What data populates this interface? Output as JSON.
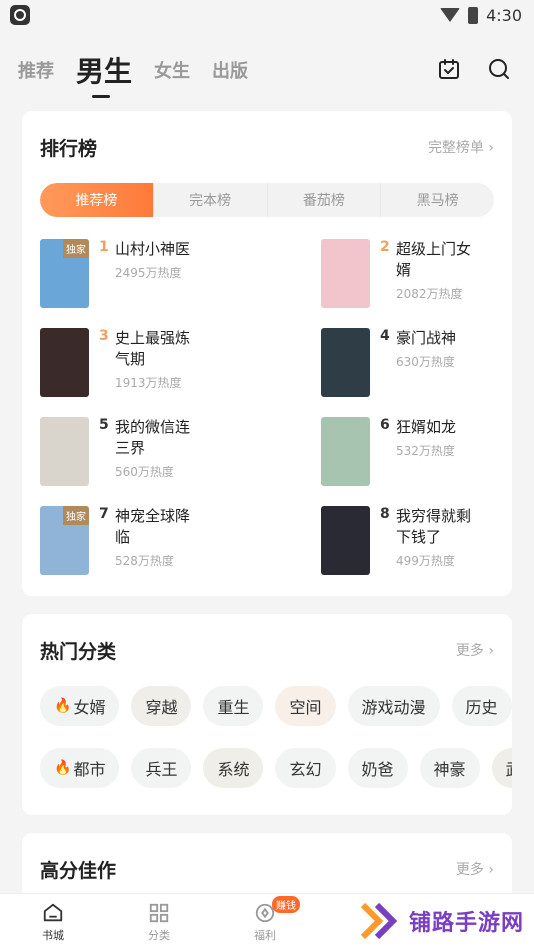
{
  "status": {
    "time": "4:30"
  },
  "topnav": {
    "tabs": [
      {
        "label": "推荐"
      },
      {
        "label": "男生"
      },
      {
        "label": "女生"
      },
      {
        "label": "出版"
      }
    ]
  },
  "ranking": {
    "title": "排行榜",
    "more": "完整榜单",
    "tabs": [
      "推荐榜",
      "完本榜",
      "番茄榜",
      "黑马榜"
    ],
    "books": [
      {
        "rank": "1",
        "title": "山村小神医",
        "heat": "2495万热度",
        "badge": "独家",
        "cover_color": "#6aa6d8"
      },
      {
        "rank": "2",
        "title": "超级上门女婿",
        "heat": "2082万热度",
        "badge": "",
        "cover_color": "#f2c4cc"
      },
      {
        "rank": "3",
        "title": "史上最强炼气期",
        "heat": "1913万热度",
        "badge": "",
        "cover_color": "#3a2a2a"
      },
      {
        "rank": "4",
        "title": "豪门战神",
        "heat": "630万热度",
        "badge": "",
        "cover_color": "#2f3e46"
      },
      {
        "rank": "5",
        "title": "我的微信连三界",
        "heat": "560万热度",
        "badge": "",
        "cover_color": "#d9d4cc"
      },
      {
        "rank": "6",
        "title": "狂婿如龙",
        "heat": "532万热度",
        "badge": "",
        "cover_color": "#a7c4b0"
      },
      {
        "rank": "7",
        "title": "神宠全球降临",
        "heat": "528万热度",
        "badge": "独家",
        "cover_color": "#8fb4d8"
      },
      {
        "rank": "8",
        "title": "我穷得就剩下钱了",
        "heat": "499万热度",
        "badge": "",
        "cover_color": "#2a2a34"
      }
    ]
  },
  "categories": {
    "title": "热门分类",
    "more": "更多",
    "row1": [
      "女婿",
      "穿越",
      "重生",
      "空间",
      "游戏动漫",
      "历史"
    ],
    "row2": [
      "都市",
      "兵王",
      "系统",
      "玄幻",
      "奶爸",
      "神豪",
      "武侠"
    ]
  },
  "high": {
    "title": "高分佳作",
    "more": "更多"
  },
  "bottom": {
    "items": [
      "书城",
      "分类",
      "福利"
    ],
    "badge": "赚钱"
  },
  "watermark": "铺路手游网",
  "colors": {
    "accent": "#ff7a3a",
    "rank_top": "#f0a060"
  }
}
